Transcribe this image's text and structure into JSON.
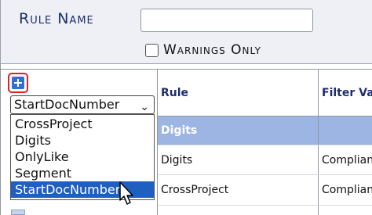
{
  "filter": {
    "rule_name_label": "Rule Name",
    "rule_name_value": "",
    "warnings_only_label": "Warnings Only",
    "warnings_only_checked": false
  },
  "grid": {
    "columns": [
      "",
      "Rule",
      "Filter Va"
    ],
    "rows": [
      {
        "rule": "Digits",
        "filter": "",
        "selected": true
      },
      {
        "rule": "Digits",
        "filter": "Complian",
        "selected": false
      },
      {
        "rule": "CrossProject",
        "filter": "Complian",
        "selected": false
      }
    ]
  },
  "rule_select": {
    "value": "StartDocNumber",
    "options": [
      "CrossProject",
      "Digits",
      "OnlyLike",
      "Segment",
      "StartDocNumber"
    ],
    "highlighted": "StartDocNumber"
  },
  "icons": {
    "add": "plus-square-icon",
    "dropdown": "chevron-down-icon",
    "cursor": "mouse-pointer-icon"
  },
  "colors": {
    "accent": "#1f2e6b",
    "selected_row": "#9db5e3",
    "highlight_option": "#1f5fbf",
    "add_button_border": "#e02020"
  }
}
